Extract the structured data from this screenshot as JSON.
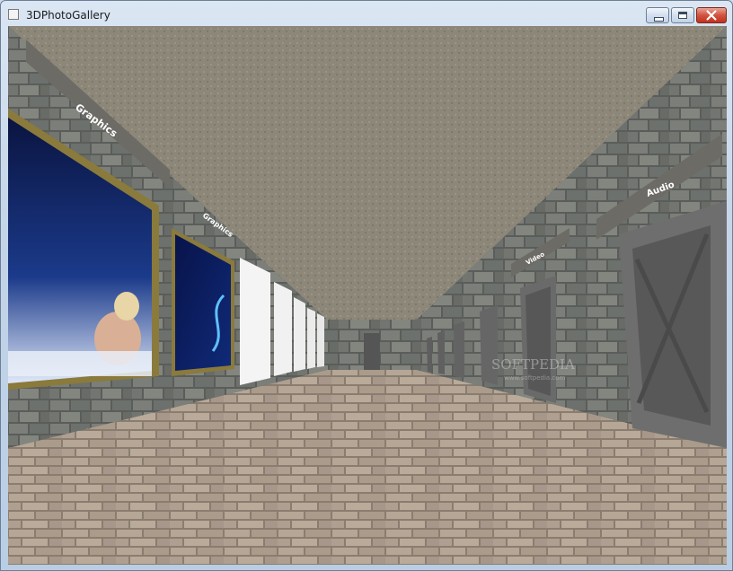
{
  "window": {
    "title": "3DPhotoGallery",
    "app_icon": "window-app-icon",
    "controls": [
      "minimize-icon",
      "maximize-icon",
      "close-icon"
    ]
  },
  "scene": {
    "room_labels": [
      "Graphics",
      "Graphics",
      "Audio",
      "Video"
    ],
    "watermark": "SOFTPEDIA",
    "watermark_sub": "www.softpedia.com",
    "colors": {
      "ceiling": "#8d877a",
      "floor": "#a8998a",
      "wall": "#5f625f",
      "frame": "#8a7a3c",
      "blank_canvas": "#f4f4f4",
      "door": "#6a6a6a"
    }
  }
}
